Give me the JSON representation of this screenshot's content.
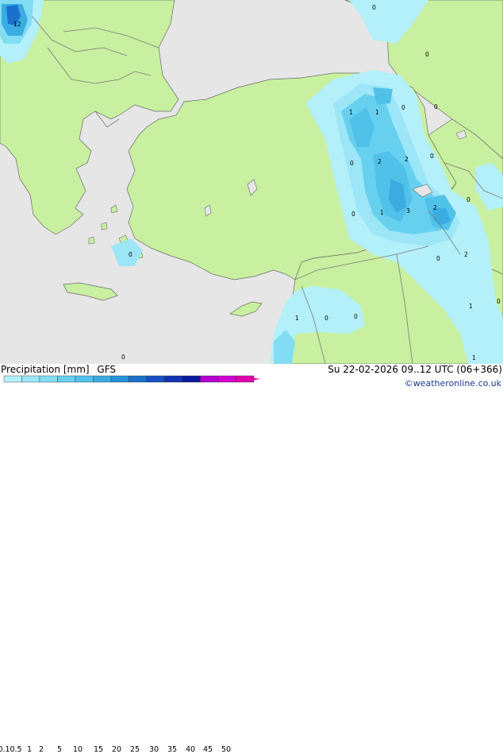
{
  "product": {
    "title": "Precipitation [mm]",
    "model": "GFS"
  },
  "valid_time": "Su 22-02-2026 09..12 UTC (06+366)",
  "credit": "©weatheronline.co.uk",
  "legend": {
    "ticks": [
      "0.1",
      "0.5",
      "1",
      "2",
      "5",
      "10",
      "15",
      "20",
      "25",
      "30",
      "35",
      "40",
      "45",
      "50"
    ],
    "colors": [
      "#b4f0fa",
      "#9ce6f7",
      "#82dcf3",
      "#68d0ef",
      "#50c2ea",
      "#3aace2",
      "#2792d8",
      "#1a70cc",
      "#1650c2",
      "#1232b2",
      "#0c189a",
      "#b400d2",
      "#d200d2",
      "#e100aa"
    ]
  },
  "colors": {
    "sea": "#e6e6e6",
    "land": "#c8f0a0",
    "border": "#7a7a7a",
    "coast": "#6a6a6a"
  },
  "map_labels": [
    {
      "text": "12"
    },
    {
      "text": "0"
    },
    {
      "text": "0"
    },
    {
      "text": "1"
    },
    {
      "text": "1"
    },
    {
      "text": "0"
    },
    {
      "text": "0"
    },
    {
      "text": "2"
    },
    {
      "text": "2"
    },
    {
      "text": "0"
    },
    {
      "text": "0"
    },
    {
      "text": "1"
    },
    {
      "text": "3"
    },
    {
      "text": "2"
    },
    {
      "text": "0"
    },
    {
      "text": "0"
    },
    {
      "text": "0"
    },
    {
      "text": "2"
    },
    {
      "text": "0"
    },
    {
      "text": "1"
    },
    {
      "text": "0"
    },
    {
      "text": "0"
    },
    {
      "text": "1"
    },
    {
      "text": "0"
    },
    {
      "text": "0"
    },
    {
      "text": "1"
    }
  ]
}
